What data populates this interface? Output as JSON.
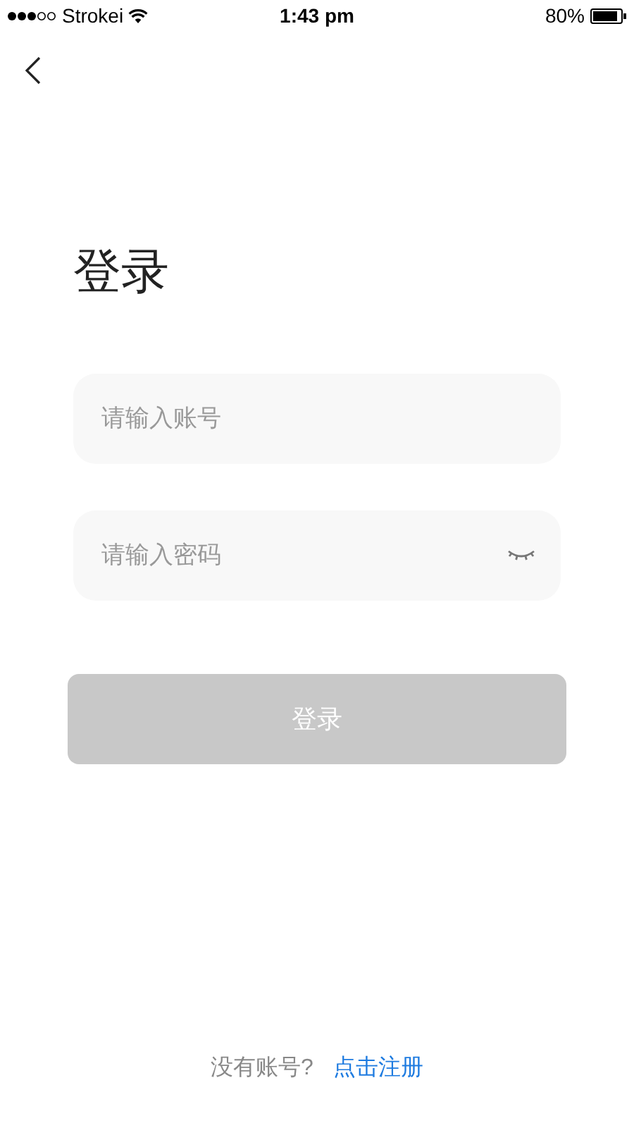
{
  "status_bar": {
    "carrier": "Strokei",
    "time": "1:43 pm",
    "battery": "80%"
  },
  "title": "登录",
  "fields": [
    {
      "placeholder": "请输入账号",
      "kind": "text"
    },
    {
      "placeholder": "请输入密码",
      "kind": "password"
    }
  ],
  "login_button": {
    "label": "登录",
    "disabled": true
  },
  "footer": {
    "prompt": "没有账号?",
    "link": "点击注册"
  }
}
